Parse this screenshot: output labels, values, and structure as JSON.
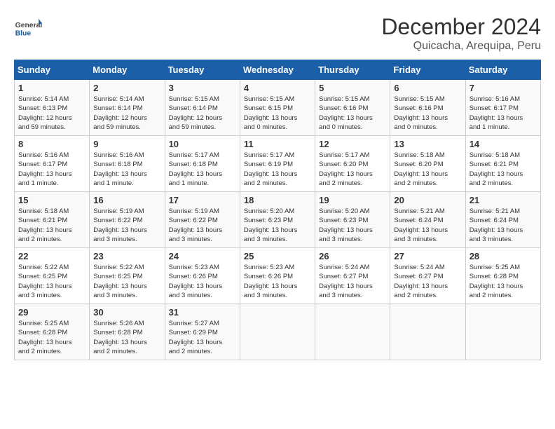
{
  "logo": {
    "general": "General",
    "blue": "Blue"
  },
  "title": "December 2024",
  "location": "Quicacha, Arequipa, Peru",
  "days_of_week": [
    "Sunday",
    "Monday",
    "Tuesday",
    "Wednesday",
    "Thursday",
    "Friday",
    "Saturday"
  ],
  "weeks": [
    [
      {
        "day": 1,
        "info": "Sunrise: 5:14 AM\nSunset: 6:13 PM\nDaylight: 12 hours\nand 59 minutes."
      },
      {
        "day": 2,
        "info": "Sunrise: 5:14 AM\nSunset: 6:14 PM\nDaylight: 12 hours\nand 59 minutes."
      },
      {
        "day": 3,
        "info": "Sunrise: 5:15 AM\nSunset: 6:14 PM\nDaylight: 12 hours\nand 59 minutes."
      },
      {
        "day": 4,
        "info": "Sunrise: 5:15 AM\nSunset: 6:15 PM\nDaylight: 13 hours\nand 0 minutes."
      },
      {
        "day": 5,
        "info": "Sunrise: 5:15 AM\nSunset: 6:16 PM\nDaylight: 13 hours\nand 0 minutes."
      },
      {
        "day": 6,
        "info": "Sunrise: 5:15 AM\nSunset: 6:16 PM\nDaylight: 13 hours\nand 0 minutes."
      },
      {
        "day": 7,
        "info": "Sunrise: 5:16 AM\nSunset: 6:17 PM\nDaylight: 13 hours\nand 1 minute."
      }
    ],
    [
      {
        "day": 8,
        "info": "Sunrise: 5:16 AM\nSunset: 6:17 PM\nDaylight: 13 hours\nand 1 minute."
      },
      {
        "day": 9,
        "info": "Sunrise: 5:16 AM\nSunset: 6:18 PM\nDaylight: 13 hours\nand 1 minute."
      },
      {
        "day": 10,
        "info": "Sunrise: 5:17 AM\nSunset: 6:18 PM\nDaylight: 13 hours\nand 1 minute."
      },
      {
        "day": 11,
        "info": "Sunrise: 5:17 AM\nSunset: 6:19 PM\nDaylight: 13 hours\nand 2 minutes."
      },
      {
        "day": 12,
        "info": "Sunrise: 5:17 AM\nSunset: 6:20 PM\nDaylight: 13 hours\nand 2 minutes."
      },
      {
        "day": 13,
        "info": "Sunrise: 5:18 AM\nSunset: 6:20 PM\nDaylight: 13 hours\nand 2 minutes."
      },
      {
        "day": 14,
        "info": "Sunrise: 5:18 AM\nSunset: 6:21 PM\nDaylight: 13 hours\nand 2 minutes."
      }
    ],
    [
      {
        "day": 15,
        "info": "Sunrise: 5:18 AM\nSunset: 6:21 PM\nDaylight: 13 hours\nand 2 minutes."
      },
      {
        "day": 16,
        "info": "Sunrise: 5:19 AM\nSunset: 6:22 PM\nDaylight: 13 hours\nand 3 minutes."
      },
      {
        "day": 17,
        "info": "Sunrise: 5:19 AM\nSunset: 6:22 PM\nDaylight: 13 hours\nand 3 minutes."
      },
      {
        "day": 18,
        "info": "Sunrise: 5:20 AM\nSunset: 6:23 PM\nDaylight: 13 hours\nand 3 minutes."
      },
      {
        "day": 19,
        "info": "Sunrise: 5:20 AM\nSunset: 6:23 PM\nDaylight: 13 hours\nand 3 minutes."
      },
      {
        "day": 20,
        "info": "Sunrise: 5:21 AM\nSunset: 6:24 PM\nDaylight: 13 hours\nand 3 minutes."
      },
      {
        "day": 21,
        "info": "Sunrise: 5:21 AM\nSunset: 6:24 PM\nDaylight: 13 hours\nand 3 minutes."
      }
    ],
    [
      {
        "day": 22,
        "info": "Sunrise: 5:22 AM\nSunset: 6:25 PM\nDaylight: 13 hours\nand 3 minutes."
      },
      {
        "day": 23,
        "info": "Sunrise: 5:22 AM\nSunset: 6:25 PM\nDaylight: 13 hours\nand 3 minutes."
      },
      {
        "day": 24,
        "info": "Sunrise: 5:23 AM\nSunset: 6:26 PM\nDaylight: 13 hours\nand 3 minutes."
      },
      {
        "day": 25,
        "info": "Sunrise: 5:23 AM\nSunset: 6:26 PM\nDaylight: 13 hours\nand 3 minutes."
      },
      {
        "day": 26,
        "info": "Sunrise: 5:24 AM\nSunset: 6:27 PM\nDaylight: 13 hours\nand 3 minutes."
      },
      {
        "day": 27,
        "info": "Sunrise: 5:24 AM\nSunset: 6:27 PM\nDaylight: 13 hours\nand 2 minutes."
      },
      {
        "day": 28,
        "info": "Sunrise: 5:25 AM\nSunset: 6:28 PM\nDaylight: 13 hours\nand 2 minutes."
      }
    ],
    [
      {
        "day": 29,
        "info": "Sunrise: 5:25 AM\nSunset: 6:28 PM\nDaylight: 13 hours\nand 2 minutes."
      },
      {
        "day": 30,
        "info": "Sunrise: 5:26 AM\nSunset: 6:28 PM\nDaylight: 13 hours\nand 2 minutes."
      },
      {
        "day": 31,
        "info": "Sunrise: 5:27 AM\nSunset: 6:29 PM\nDaylight: 13 hours\nand 2 minutes."
      },
      null,
      null,
      null,
      null
    ]
  ]
}
